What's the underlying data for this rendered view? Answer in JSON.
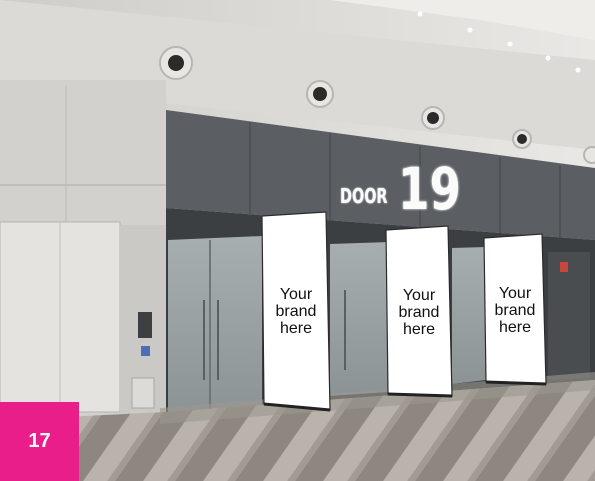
{
  "sign": {
    "word": "DOOR",
    "number": "19"
  },
  "banners": [
    {
      "text": "Your\nbrand\nhere"
    },
    {
      "text": "Your\nbrand\nhere"
    },
    {
      "text": "Your\nbrand\nhere"
    }
  ],
  "page_badge": {
    "number": "17",
    "color": "#ea1e8b"
  }
}
